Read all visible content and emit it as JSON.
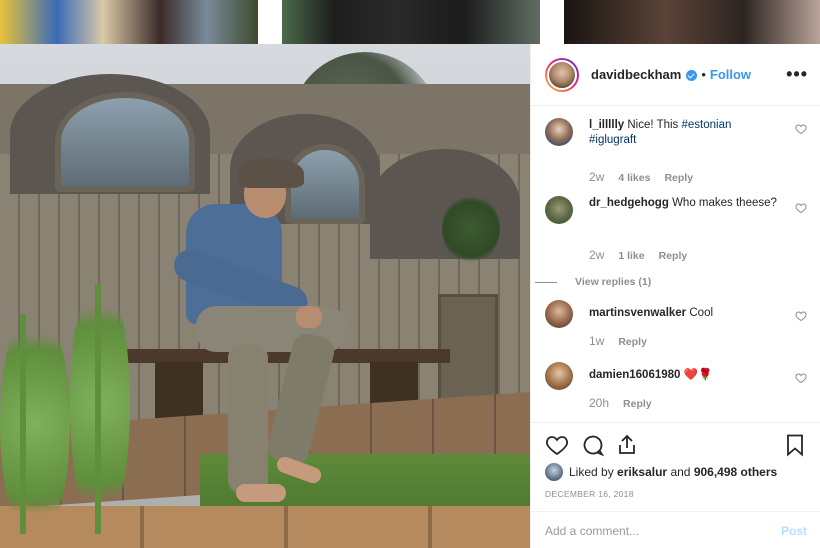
{
  "post": {
    "author": "davidbeckham",
    "separator": "•",
    "follow_label": "Follow",
    "more_label": "•••"
  },
  "comments": [
    {
      "user": "l_illllly",
      "text_plain": "Nice! This ",
      "tag1": "#estonian",
      "tag2": "#iglugraft",
      "time": "2w",
      "likes": "4 likes",
      "reply": "Reply",
      "avatar_color": "#2f4a6e"
    },
    {
      "user": "dr_hedgehogg",
      "text_plain": "Who makes theese?",
      "time": "2w",
      "likes": "1 like",
      "reply": "Reply",
      "view_replies": "View replies (1)",
      "avatar_color": "#3c5a34"
    },
    {
      "user": "martinsvenwalker",
      "text_plain": "Cool",
      "time": "1w",
      "reply": "Reply",
      "avatar_color": "#5a4236"
    },
    {
      "user": "damien16061980",
      "text_plain": "❤️🌹",
      "time": "20h",
      "reply": "Reply",
      "avatar_color": "#6b4a2e"
    }
  ],
  "actions": {
    "icons": [
      "heart-icon",
      "comment-icon",
      "share-icon",
      "bookmark-icon"
    ],
    "liked_prefix": "Liked by ",
    "liked_user": "eriksalur",
    "liked_mid": " and ",
    "liked_count": "906,498 others",
    "date": "DECEMBER 16, 2018"
  },
  "add_comment": {
    "placeholder": "Add a comment...",
    "post_label": "Post"
  },
  "colors": {
    "link_blue": "#3897f0",
    "tag_blue": "#003569",
    "muted": "#8e8e8e"
  }
}
